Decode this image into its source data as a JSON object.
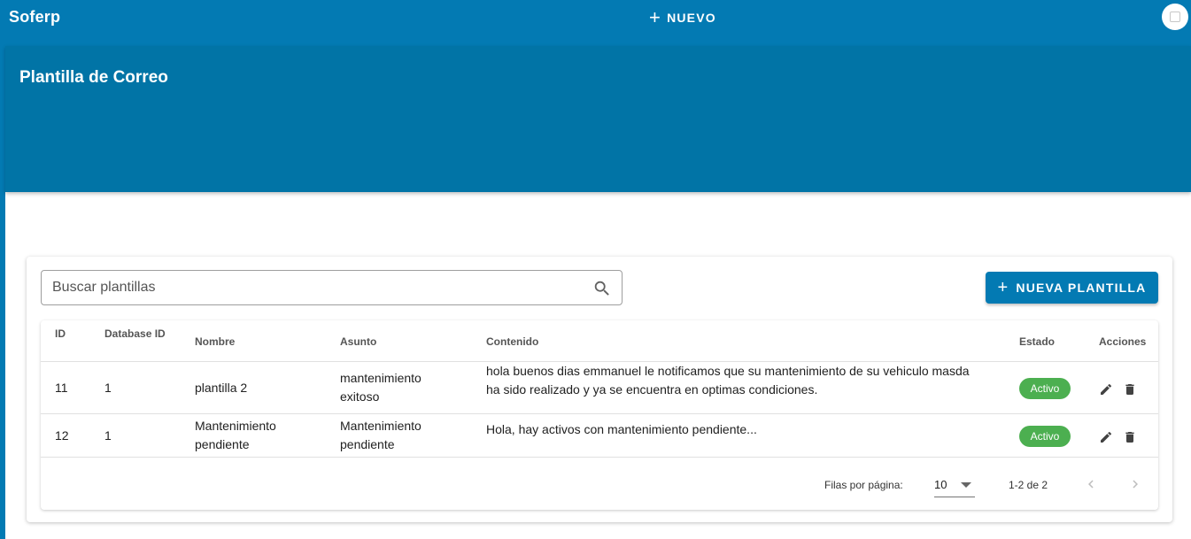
{
  "app": {
    "brand": "Soferp"
  },
  "topbar": {
    "new_label": "NUEVO"
  },
  "page": {
    "title": "Plantilla de Correo"
  },
  "search": {
    "placeholder": "Buscar plantillas"
  },
  "actions": {
    "new_template_label": "NUEVA PLANTILLA"
  },
  "table": {
    "headers": {
      "id": "ID",
      "database_id": "Database ID",
      "nombre": "Nombre",
      "asunto": "Asunto",
      "contenido": "Contenido",
      "estado": "Estado",
      "acciones": "Acciones"
    },
    "rows": [
      {
        "id": "11",
        "database_id": "1",
        "nombre": "plantilla 2",
        "asunto_line1": "mantenimiento",
        "asunto_line2": "exitoso",
        "contenido_line1": "hola buenos dias emmanuel le notificamos que su mantenimiento de su vehiculo masda",
        "contenido_line2": "ha sido realizado y ya se encuentra en optimas condiciones.",
        "estado": "Activo"
      },
      {
        "id": "12",
        "database_id": "1",
        "nombre_line1": "Mantenimiento",
        "nombre_line2": "pendiente",
        "asunto_line1": "Mantenimiento",
        "asunto_line2": "pendiente",
        "contenido": "Hola, hay activos con mantenimiento pendiente...",
        "estado": "Activo"
      }
    ]
  },
  "pagination": {
    "rows_per_page_label": "Filas por página:",
    "rows_per_page_value": "10",
    "range": "1-2 de 2"
  },
  "colors": {
    "primary": "#037ab3",
    "hero": "#0174a6",
    "status_active": "#4caf50"
  },
  "icons": {
    "add": "plus-icon",
    "search": "search-icon",
    "edit": "pencil-icon",
    "delete": "trash-icon",
    "prev": "chevron-left-icon",
    "next": "chevron-right-icon",
    "avatar": "broken-image-icon",
    "dropdown": "caret-down-icon"
  }
}
